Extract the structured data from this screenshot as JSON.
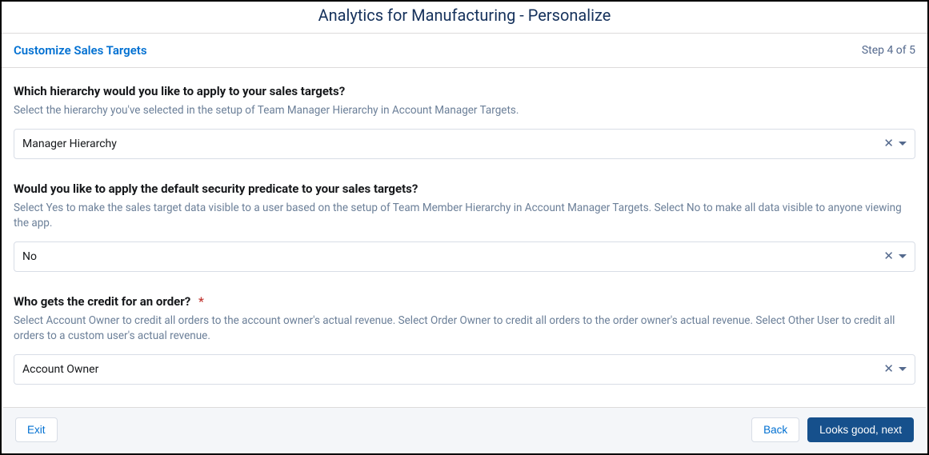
{
  "header": {
    "title": "Analytics for Manufacturing - Personalize"
  },
  "subheader": {
    "title": "Customize Sales Targets",
    "step": "Step 4 of 5"
  },
  "fields": {
    "hierarchy": {
      "label": "Which hierarchy would you like to apply to your sales targets?",
      "help": "Select the hierarchy you've selected in the setup of Team Manager Hierarchy in Account Manager Targets.",
      "value": "Manager Hierarchy"
    },
    "security": {
      "label": "Would you like to apply the default security predicate to your sales targets?",
      "help": "Select Yes to make the sales target data visible to a user based on the setup of Team Member Hierarchy in Account Manager Targets. Select No to make all data visible to anyone viewing the app.",
      "value": "No"
    },
    "credit": {
      "label": "Who gets the credit for an order?",
      "required_marker": "*",
      "help": "Select Account Owner to credit all orders to the account owner's actual revenue. Select Order Owner to credit all orders to the order owner's actual revenue. Select Other User to credit all orders to a custom user's actual revenue.",
      "value": "Account Owner"
    }
  },
  "footer": {
    "exit": "Exit",
    "back": "Back",
    "next": "Looks good, next"
  }
}
